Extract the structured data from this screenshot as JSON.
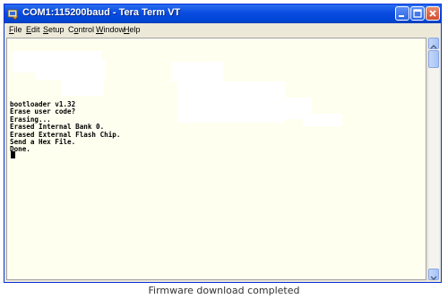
{
  "window": {
    "title": "COM1:115200baud - Tera Term VT"
  },
  "menu": [
    {
      "prefix": "",
      "key": "F",
      "rest": "ile"
    },
    {
      "prefix": "",
      "key": "E",
      "rest": "dit"
    },
    {
      "prefix": "",
      "key": "S",
      "rest": "etup"
    },
    {
      "prefix": "C",
      "key": "o",
      "rest": "ntrol"
    },
    {
      "prefix": "",
      "key": "W",
      "rest": "indow"
    },
    {
      "prefix": "",
      "key": "H",
      "rest": "elp"
    }
  ],
  "terminal": {
    "lines": [
      "bootloader v1.32",
      "Erase user code?",
      "Erasing...",
      "Erased Internal Bank 0.",
      "Erased External Flash Chip.",
      "Send a Hex File.",
      "Done."
    ]
  },
  "caption": "Firmware download completed"
}
